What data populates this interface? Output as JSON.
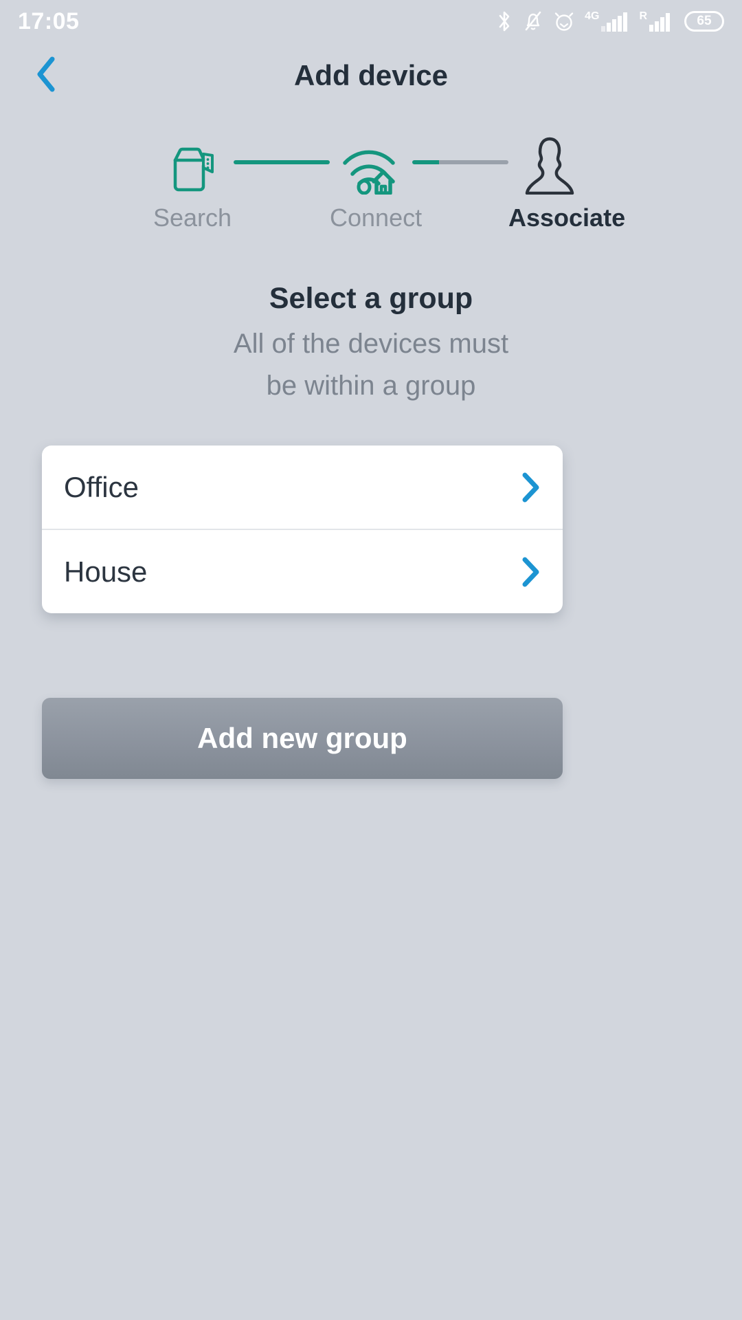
{
  "status_bar": {
    "time": "17:05",
    "battery_level": "65",
    "network_label": "4G",
    "roaming_label": "R",
    "icons": [
      "bluetooth-icon",
      "bell-muted-icon",
      "alarm-clock-icon",
      "signal-4g-icon",
      "signal-roaming-icon",
      "battery-icon"
    ]
  },
  "header": {
    "title": "Add device",
    "back_icon": "chevron-left-icon"
  },
  "stepper": {
    "steps": [
      {
        "label": "Search",
        "icon": "package-box-icon",
        "state": "done"
      },
      {
        "label": "Connect",
        "icon": "wifi-home-icon",
        "state": "done"
      },
      {
        "label": "Associate",
        "icon": "person-icon",
        "state": "active"
      }
    ],
    "connectors": [
      {
        "state": "complete"
      },
      {
        "state": "partial"
      }
    ],
    "colors": {
      "done": "#14967e",
      "pending": "#9aa1ab",
      "active_text": "#242f3b",
      "inactive_text": "#8b929c"
    }
  },
  "main": {
    "title": "Select a group",
    "subtitle_line1": "All of the devices must",
    "subtitle_line2": "be within a group",
    "groups": [
      {
        "name": "Office",
        "chevron": "chevron-right-icon"
      },
      {
        "name": "House",
        "chevron": "chevron-right-icon"
      }
    ],
    "add_group_button": "Add new group"
  },
  "colors": {
    "background": "#d2d6dd",
    "accent_blue": "#1c94d2",
    "card": "#ffffff",
    "text_dark": "#242f3b",
    "text_muted": "#7c848f"
  }
}
